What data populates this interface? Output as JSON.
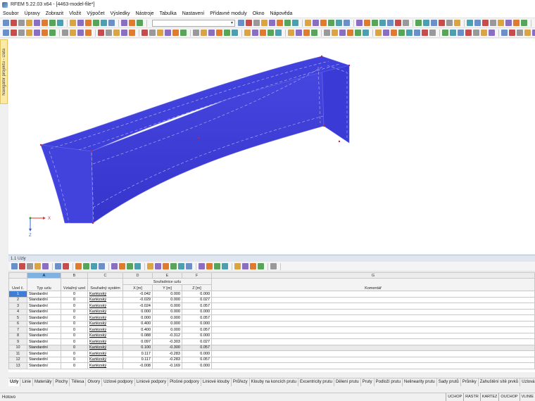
{
  "window": {
    "title": "RFEM 5.22.03 x64 - [4463-model-file*]"
  },
  "menu": [
    "Soubor",
    "Úpravy",
    "Zobrazit",
    "Vložit",
    "Výpočet",
    "Výsledky",
    "Nástroje",
    "Tabulka",
    "Nastavení",
    "Přídavné moduly",
    "Okno",
    "Nápověda"
  ],
  "navigator_tab": "Navigátor projektu - Data",
  "axes": {
    "x": "X",
    "z": "Z"
  },
  "panel": {
    "title": "1.1 Uzly"
  },
  "table": {
    "col_letters": [
      "A",
      "B",
      "C",
      "D",
      "E",
      "F",
      "G"
    ],
    "headers": {
      "uzel": "Uzel č.",
      "typ": "Typ uzlu",
      "vztazny": "Vztažný uzel",
      "system": "Souřadný systém",
      "souradnice": "Souřadnice uzlu",
      "x": "X [m]",
      "y": "Y [m]",
      "z": "Z [m]",
      "komentar": "Komentář"
    },
    "rows": [
      [
        "1",
        "Standardní",
        "0",
        "Kartézský",
        "-0.042",
        "0.000",
        "0.000"
      ],
      [
        "2",
        "Standardní",
        "0",
        "Kartézský",
        "-0.029",
        "0.000",
        "0.027"
      ],
      [
        "3",
        "Standardní",
        "0",
        "Kartézský",
        "-0.024",
        "0.000",
        "0.057"
      ],
      [
        "4",
        "Standardní",
        "0",
        "Kartézský",
        "0.000",
        "0.000",
        "0.000"
      ],
      [
        "5",
        "Standardní",
        "0",
        "Kartézský",
        "0.000",
        "0.000",
        "0.057"
      ],
      [
        "6",
        "Standardní",
        "0",
        "Kartézský",
        "0.400",
        "0.000",
        "0.000"
      ],
      [
        "7",
        "Standardní",
        "0",
        "Kartézský",
        "0.400",
        "0.000",
        "0.057"
      ],
      [
        "8",
        "Standardní",
        "0",
        "Kartézský",
        "0.088",
        "-0.312",
        "0.000"
      ],
      [
        "9",
        "Standardní",
        "0",
        "Kartézský",
        "0.097",
        "-0.303",
        "0.027"
      ],
      [
        "10",
        "Standardní",
        "0",
        "Kartézský",
        "0.100",
        "-0.300",
        "0.057"
      ],
      [
        "11",
        "Standardní",
        "0",
        "Kartézský",
        "0.117",
        "-0.283",
        "0.000"
      ],
      [
        "12",
        "Standardní",
        "0",
        "Kartézský",
        "0.117",
        "-0.283",
        "0.057"
      ],
      [
        "13",
        "Standardní",
        "0",
        "Kartézský",
        "-0.008",
        "-0.169",
        "0.000"
      ]
    ]
  },
  "bottom_tabs": [
    "Uzly",
    "Linie",
    "Materiály",
    "Plochy",
    "Tělesa",
    "Otvory",
    "Uzlové podpory",
    "Liniové podpory",
    "Plošné podpory",
    "Liniové klouby",
    "Průřezy",
    "Klouby na koncích prutu",
    "Excentricity prutu",
    "Dělení prutu",
    "Pruty",
    "Podloží prutu",
    "Nelinearity prutu",
    "Sady prutů",
    "Průniky",
    "Zahuštění sítě prvků",
    "Uzlová uv"
  ],
  "status": {
    "text": "Hotovo",
    "buttons": [
      "UCHOP",
      "RASTR",
      "KARTEZ",
      "OUCHOP",
      "VLINIE"
    ]
  },
  "colors": {
    "model_fill": "#3c3cdc",
    "selection": "#3f7ed8",
    "navigator_bg": "#fbe9a8"
  }
}
